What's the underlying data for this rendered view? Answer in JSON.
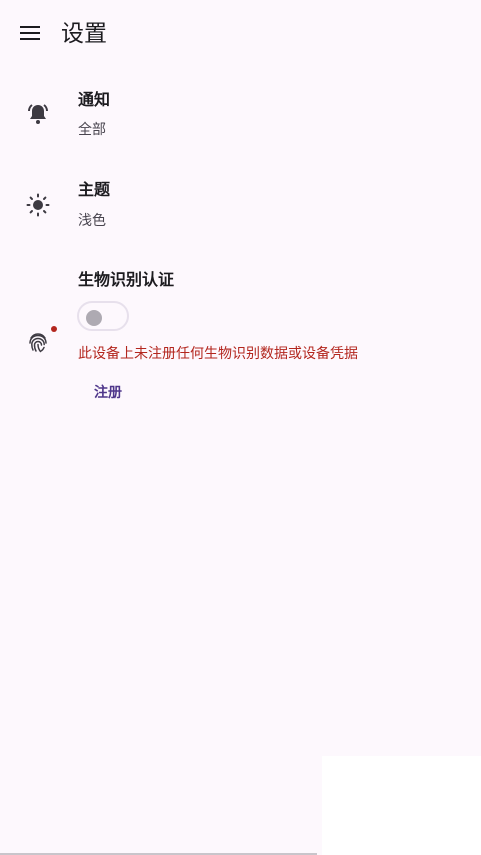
{
  "header": {
    "title": "设置",
    "menu_icon": "menu-icon"
  },
  "preferences": {
    "notifications": {
      "icon": "bell-icon",
      "title": "通知",
      "summary": "全部"
    },
    "theme": {
      "icon": "sun-icon",
      "title": "主题",
      "summary": "浅色"
    },
    "biometric": {
      "icon": "fingerprint-icon",
      "title": "生物识别认证",
      "switch_on": false,
      "error": "此设备上未注册任何生物识别数据或设备凭据",
      "action_label": "注册"
    }
  },
  "colors": {
    "background": "#fdf8fd",
    "error": "#b3261e",
    "accent": "#4f378b",
    "text": "#1c1b1f",
    "secondary_text": "#49454f"
  }
}
